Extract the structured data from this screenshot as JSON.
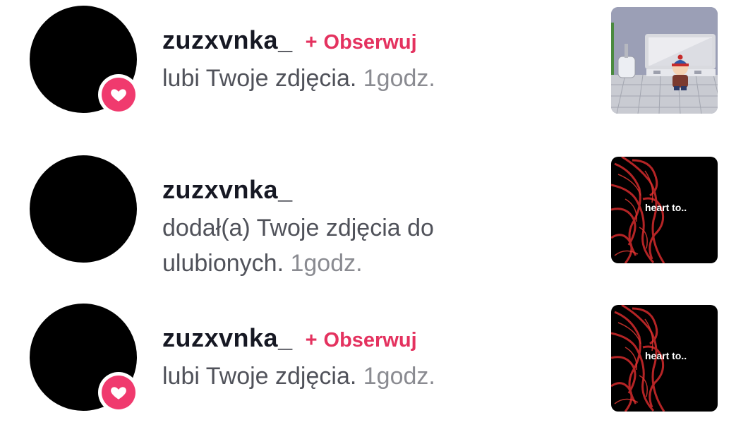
{
  "notifications": [
    {
      "username": "zuzxvnka_",
      "follow_label": "Obserwuj",
      "follow_plus": "+",
      "action": "lubi Twoje zdjęcia.",
      "time": "1godz.",
      "thumbnail_caption": "",
      "badge_icon": "heart-icon"
    },
    {
      "username": "zuzxvnka_",
      "action_line1": "dodał(a) Twoje zdjęcia do",
      "action_line2": "ulubionych.",
      "time": "1godz.",
      "thumbnail_caption": "heart to.."
    },
    {
      "username": "zuzxvnka_",
      "follow_label": "Obserwuj",
      "follow_plus": "+",
      "action": "lubi Twoje zdjęcia.",
      "time": "1godz.",
      "thumbnail_caption": "heart to..",
      "badge_icon": "heart-icon"
    }
  ],
  "colors": {
    "accent": "#e4325f",
    "badge": "#f03a6e",
    "text_primary": "#161823",
    "text_secondary": "#50525a",
    "text_time": "#8a8b91"
  }
}
